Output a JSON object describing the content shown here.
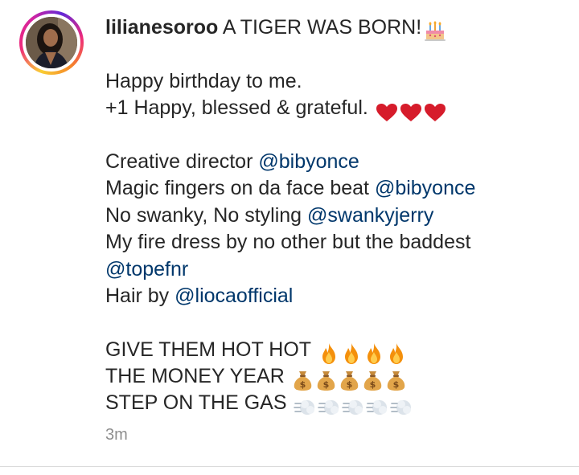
{
  "post": {
    "username": "lilianesoroo",
    "headline": "A TIGER WAS BORN!",
    "headline_emoji": "birthday-cake-icon",
    "lines": {
      "l1": "Happy birthday to me.",
      "l2": "+1  Happy, blessed & grateful.",
      "l2_emoji": "red-heart-icon",
      "l3_text": "Creative director ",
      "l3_mention": "@bibyonce",
      "l4_text": "Magic fingers on da face beat ",
      "l4_mention": "@bibyonce",
      "l5_text": "No swanky, No styling ",
      "l5_mention": "@swankyjerry",
      "l6_text": "My fire dress by no other but the baddest",
      "l7_mention": "@topefnr",
      "l8_text": "Hair by ",
      "l8_mention": "@liocaofficial",
      "l9": "GIVE THEM HOT HOT",
      "l9_emoji": "fire-icon",
      "l10": "THE MONEY YEAR",
      "l10_emoji": "money-bag-icon",
      "l11": "STEP ON THE GAS",
      "l11_emoji": "dashing-away-icon"
    },
    "timestamp": "3m"
  },
  "colors": {
    "mention": "#00376b",
    "text": "#262626",
    "muted": "#8e8e8e",
    "divider": "#dbdbdb"
  }
}
